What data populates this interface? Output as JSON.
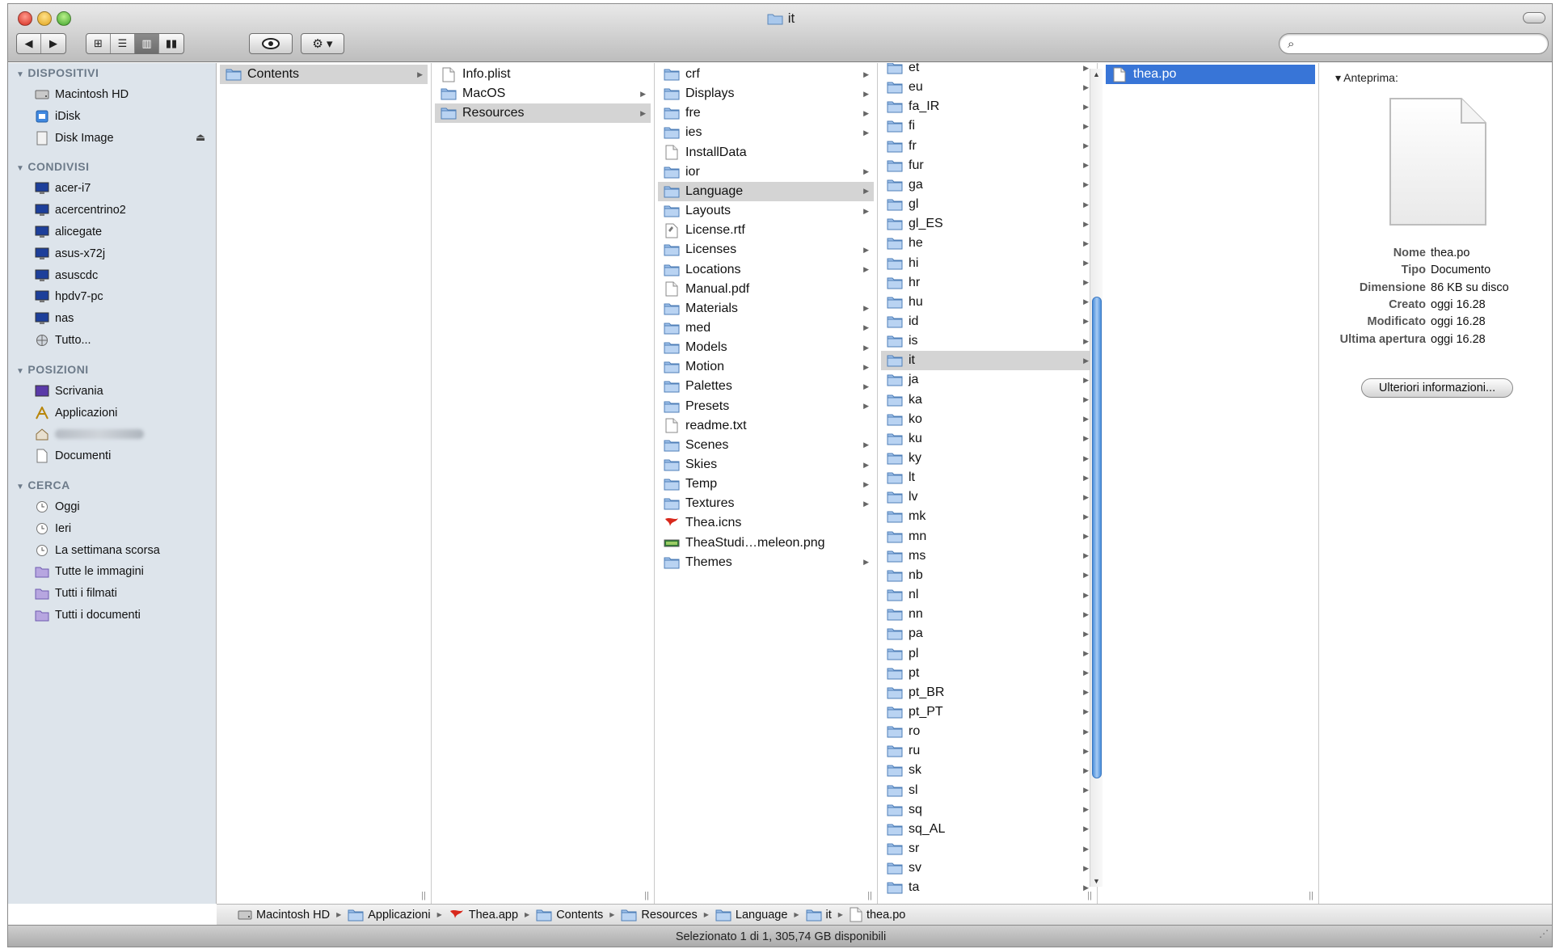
{
  "window": {
    "title": "it"
  },
  "toolbar": {
    "nav_back": "◀",
    "nav_fwd": "▶",
    "view_icons": "⊞",
    "view_list": "☰",
    "view_columns": "▥",
    "view_coverflow": "▮▮",
    "quicklook_icon": "eye-icon",
    "action_icon": "gear-icon",
    "action_label": "⚙ ▾",
    "search_placeholder": ""
  },
  "sidebar": {
    "sections": [
      {
        "label": "DISPOSITIVI",
        "items": [
          {
            "label": "Macintosh HD",
            "icon": "hard-drive-icon"
          },
          {
            "label": "iDisk",
            "icon": "idisk-icon"
          },
          {
            "label": "Disk Image",
            "icon": "disk-image-icon",
            "eject": "⏏"
          }
        ]
      },
      {
        "label": "CONDIVISI",
        "items": [
          {
            "label": "acer-i7",
            "icon": "computer-icon"
          },
          {
            "label": "acercentrino2",
            "icon": "computer-icon"
          },
          {
            "label": "alicegate",
            "icon": "computer-icon"
          },
          {
            "label": "asus-x72j",
            "icon": "computer-icon"
          },
          {
            "label": "asuscdc",
            "icon": "computer-icon"
          },
          {
            "label": "hpdv7-pc",
            "icon": "computer-icon"
          },
          {
            "label": "nas",
            "icon": "computer-icon"
          },
          {
            "label": "Tutto...",
            "icon": "network-icon"
          }
        ]
      },
      {
        "label": "POSIZIONI",
        "items": [
          {
            "label": "Scrivania",
            "icon": "desktop-icon"
          },
          {
            "label": "Applicazioni",
            "icon": "applications-icon"
          },
          {
            "label": "",
            "icon": "home-icon"
          },
          {
            "label": "Documenti",
            "icon": "documents-icon"
          }
        ]
      },
      {
        "label": "CERCA",
        "items": [
          {
            "label": "Oggi",
            "icon": "clock-icon"
          },
          {
            "label": "Ieri",
            "icon": "clock-icon"
          },
          {
            "label": "La settimana scorsa",
            "icon": "clock-icon"
          },
          {
            "label": "Tutte le immagini",
            "icon": "smart-folder-icon"
          },
          {
            "label": "Tutti i filmati",
            "icon": "smart-folder-icon"
          },
          {
            "label": "Tutti i documenti",
            "icon": "smart-folder-icon"
          }
        ]
      }
    ]
  },
  "columns": [
    {
      "items": [
        {
          "name": "Contents",
          "type": "folder",
          "arrow": true,
          "selected": true
        }
      ]
    },
    {
      "items": [
        {
          "name": "Info.plist",
          "type": "file",
          "arrow": false
        },
        {
          "name": "MacOS",
          "type": "folder",
          "arrow": true
        },
        {
          "name": "Resources",
          "type": "folder",
          "arrow": true,
          "selected": true
        }
      ]
    },
    {
      "items": [
        {
          "name": "crf",
          "type": "folder",
          "arrow": true
        },
        {
          "name": "Displays",
          "type": "folder",
          "arrow": true
        },
        {
          "name": "fre",
          "type": "folder",
          "arrow": true
        },
        {
          "name": "ies",
          "type": "folder",
          "arrow": true
        },
        {
          "name": "InstallData",
          "type": "file",
          "arrow": false
        },
        {
          "name": "ior",
          "type": "folder",
          "arrow": true
        },
        {
          "name": "Language",
          "type": "folder",
          "arrow": true,
          "selected": true
        },
        {
          "name": "Layouts",
          "type": "folder",
          "arrow": true
        },
        {
          "name": "License.rtf",
          "type": "rtf",
          "arrow": false
        },
        {
          "name": "Licenses",
          "type": "folder",
          "arrow": true
        },
        {
          "name": "Locations",
          "type": "folder",
          "arrow": true
        },
        {
          "name": "Manual.pdf",
          "type": "file",
          "arrow": false
        },
        {
          "name": "Materials",
          "type": "folder",
          "arrow": true
        },
        {
          "name": "med",
          "type": "folder",
          "arrow": true
        },
        {
          "name": "Models",
          "type": "folder",
          "arrow": true
        },
        {
          "name": "Motion",
          "type": "folder",
          "arrow": true
        },
        {
          "name": "Palettes",
          "type": "folder",
          "arrow": true
        },
        {
          "name": "Presets",
          "type": "folder",
          "arrow": true
        },
        {
          "name": "readme.txt",
          "type": "file",
          "arrow": false
        },
        {
          "name": "Scenes",
          "type": "folder",
          "arrow": true
        },
        {
          "name": "Skies",
          "type": "folder",
          "arrow": true
        },
        {
          "name": "Temp",
          "type": "folder",
          "arrow": true
        },
        {
          "name": "Textures",
          "type": "folder",
          "arrow": true
        },
        {
          "name": "Thea.icns",
          "type": "icns",
          "arrow": false
        },
        {
          "name": "TheaStudi…meleon.png",
          "type": "png",
          "arrow": false
        },
        {
          "name": "Themes",
          "type": "folder",
          "arrow": true
        }
      ]
    },
    {
      "items": [
        {
          "name": "et",
          "type": "folder",
          "arrow": true
        },
        {
          "name": "eu",
          "type": "folder",
          "arrow": true
        },
        {
          "name": "fa_IR",
          "type": "folder",
          "arrow": true
        },
        {
          "name": "fi",
          "type": "folder",
          "arrow": true
        },
        {
          "name": "fr",
          "type": "folder",
          "arrow": true
        },
        {
          "name": "fur",
          "type": "folder",
          "arrow": true
        },
        {
          "name": "ga",
          "type": "folder",
          "arrow": true
        },
        {
          "name": "gl",
          "type": "folder",
          "arrow": true
        },
        {
          "name": "gl_ES",
          "type": "folder",
          "arrow": true
        },
        {
          "name": "he",
          "type": "folder",
          "arrow": true
        },
        {
          "name": "hi",
          "type": "folder",
          "arrow": true
        },
        {
          "name": "hr",
          "type": "folder",
          "arrow": true
        },
        {
          "name": "hu",
          "type": "folder",
          "arrow": true
        },
        {
          "name": "id",
          "type": "folder",
          "arrow": true
        },
        {
          "name": "is",
          "type": "folder",
          "arrow": true
        },
        {
          "name": "it",
          "type": "folder",
          "arrow": true,
          "selected": true
        },
        {
          "name": "ja",
          "type": "folder",
          "arrow": true
        },
        {
          "name": "ka",
          "type": "folder",
          "arrow": true
        },
        {
          "name": "ko",
          "type": "folder",
          "arrow": true
        },
        {
          "name": "ku",
          "type": "folder",
          "arrow": true
        },
        {
          "name": "ky",
          "type": "folder",
          "arrow": true
        },
        {
          "name": "lt",
          "type": "folder",
          "arrow": true
        },
        {
          "name": "lv",
          "type": "folder",
          "arrow": true
        },
        {
          "name": "mk",
          "type": "folder",
          "arrow": true
        },
        {
          "name": "mn",
          "type": "folder",
          "arrow": true
        },
        {
          "name": "ms",
          "type": "folder",
          "arrow": true
        },
        {
          "name": "nb",
          "type": "folder",
          "arrow": true
        },
        {
          "name": "nl",
          "type": "folder",
          "arrow": true
        },
        {
          "name": "nn",
          "type": "folder",
          "arrow": true
        },
        {
          "name": "pa",
          "type": "folder",
          "arrow": true
        },
        {
          "name": "pl",
          "type": "folder",
          "arrow": true
        },
        {
          "name": "pt",
          "type": "folder",
          "arrow": true
        },
        {
          "name": "pt_BR",
          "type": "folder",
          "arrow": true
        },
        {
          "name": "pt_PT",
          "type": "folder",
          "arrow": true
        },
        {
          "name": "ro",
          "type": "folder",
          "arrow": true
        },
        {
          "name": "ru",
          "type": "folder",
          "arrow": true
        },
        {
          "name": "sk",
          "type": "folder",
          "arrow": true
        },
        {
          "name": "sl",
          "type": "folder",
          "arrow": true
        },
        {
          "name": "sq",
          "type": "folder",
          "arrow": true
        },
        {
          "name": "sq_AL",
          "type": "folder",
          "arrow": true
        },
        {
          "name": "sr",
          "type": "folder",
          "arrow": true
        },
        {
          "name": "sv",
          "type": "folder",
          "arrow": true
        },
        {
          "name": "ta",
          "type": "folder",
          "arrow": true
        }
      ]
    },
    {
      "items": [
        {
          "name": "thea.po",
          "type": "file",
          "arrow": false,
          "selected": true,
          "active": true
        }
      ]
    }
  ],
  "preview": {
    "label": "Anteprima:",
    "meta": [
      {
        "k": "Nome",
        "v": "thea.po"
      },
      {
        "k": "Tipo",
        "v": "Documento"
      },
      {
        "k": "Dimensione",
        "v": "86 KB su disco"
      },
      {
        "k": "Creato",
        "v": "oggi 16.28"
      },
      {
        "k": "Modificato",
        "v": "oggi 16.28"
      },
      {
        "k": "Ultima apertura",
        "v": "oggi 16.28"
      }
    ],
    "more_button": "Ulteriori informazioni..."
  },
  "pathbar": [
    {
      "label": "Macintosh HD",
      "icon": "hard-drive-icon"
    },
    {
      "label": "Applicazioni",
      "icon": "applications-folder-icon"
    },
    {
      "label": "Thea.app",
      "icon": "thea-app-icon"
    },
    {
      "label": "Contents",
      "icon": "folder-icon"
    },
    {
      "label": "Resources",
      "icon": "folder-icon"
    },
    {
      "label": "Language",
      "icon": "folder-icon"
    },
    {
      "label": "it",
      "icon": "folder-icon"
    },
    {
      "label": "thea.po",
      "icon": "document-icon"
    }
  ],
  "status": {
    "text": "Selezionato 1 di 1, 305,74 GB disponibili"
  },
  "colors": {
    "selection_blue": "#3875d7",
    "selection_grey": "#d4d4d4",
    "sidebar_bg": "#dde4eb",
    "section_text": "#6d7b8a"
  }
}
